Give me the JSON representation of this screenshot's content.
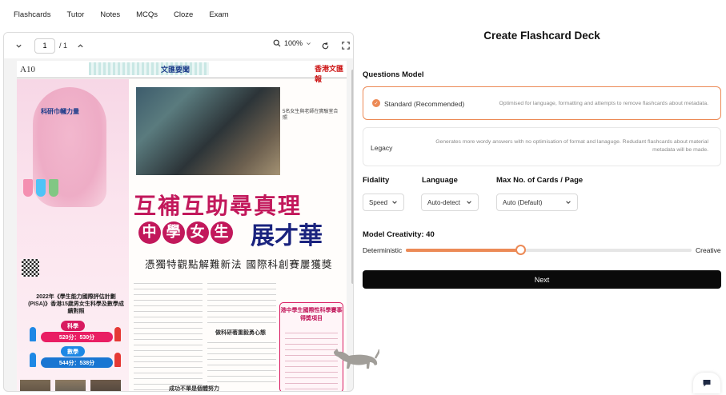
{
  "nav": {
    "items": [
      "Flashcards",
      "Tutor",
      "Notes",
      "MCQs",
      "Cloze",
      "Exam"
    ]
  },
  "viewer": {
    "page_current": "1",
    "page_total": "/ 1",
    "zoom": "100%",
    "newspaper": {
      "page_number": "A10",
      "section": "文匯要聞",
      "paper_logo": "香港文匯報",
      "brand": "科研巾幗力量",
      "headline_line1": "互補互助尋真理",
      "headline_circled": [
        "中",
        "學",
        "女",
        "生"
      ],
      "headline_line2": "展才華",
      "deck": "憑獨特觀點解難新法 國際科創賽屢獲獎",
      "pisa_title": "2022年《學生能力國際評估計劃(PISA)》香港15歲男女生科學及數學成績對照",
      "science_label": "科學",
      "science_scores": "520分：530分",
      "math_label": "數學",
      "math_scores": "544分：538分",
      "side_caption": "5名女生與老師在實驗室合照",
      "box_title": "港中學生國際性科學賽事得獎項目",
      "sub_heading": "做科研著重毅勇心態",
      "sub_heading2": "成功不單是個體努力"
    }
  },
  "panel": {
    "title": "Create Flashcard Deck",
    "questions_model_label": "Questions Model",
    "models": [
      {
        "name": "Standard (Recommended)",
        "description": "Optimised for language, formatting and attempts to remove flashcards about metadata.",
        "selected": true
      },
      {
        "name": "Legacy",
        "description_line1": "Generates more wordy answers with no optimisation of format and lanaguge. Redudant flashcards about material",
        "description_line2": "metadata will be made.",
        "selected": false
      }
    ],
    "fidelity_label": "Fidality",
    "fidelity_value": "Speed",
    "language_label": "Language",
    "language_value": "Auto-detect",
    "max_cards_label": "Max No. of Cards / Page",
    "max_cards_value": "Auto (Default)",
    "creativity_label": "Model Creativity: 40",
    "creativity_value": 40,
    "creativity_min_label": "Deterministic",
    "creativity_max_label": "Creative",
    "next_label": "Next"
  },
  "colors": {
    "accent": "#ec8a56",
    "button": "#0a0a0a"
  }
}
